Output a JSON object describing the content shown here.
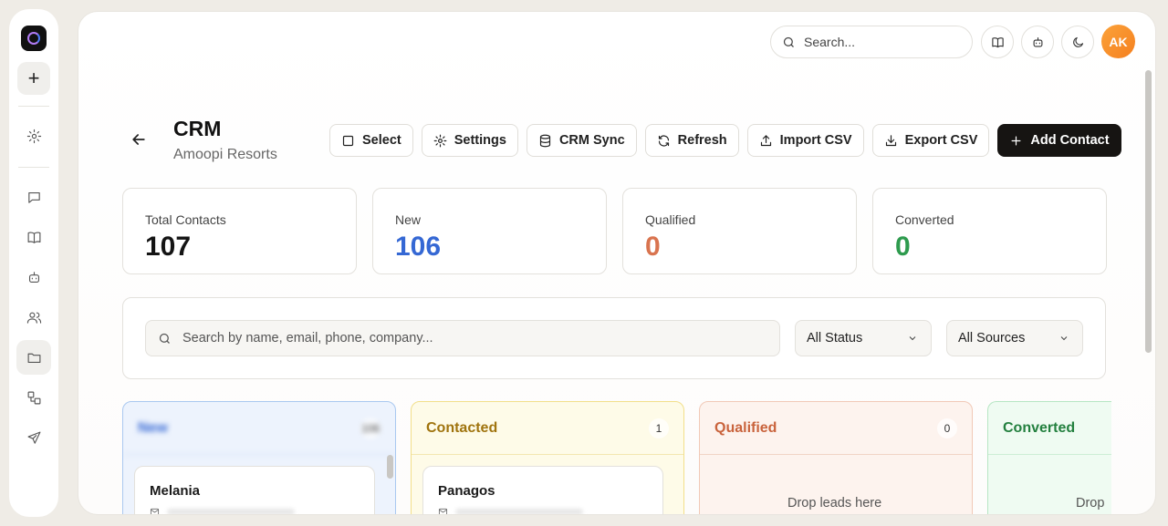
{
  "topbar": {
    "search_placeholder": "Search...",
    "avatar_initials": "AK"
  },
  "header": {
    "title": "CRM",
    "subtitle": "Amoopi Resorts"
  },
  "actions": {
    "select": "Select",
    "settings": "Settings",
    "crm_sync": "CRM Sync",
    "refresh": "Refresh",
    "import_csv": "Import CSV",
    "export_csv": "Export CSV",
    "add_contact": "Add Contact"
  },
  "stats": [
    {
      "label": "Total Contacts",
      "value": "107",
      "color": "#141414"
    },
    {
      "label": "New",
      "value": "106",
      "color": "#3568d4"
    },
    {
      "label": "Qualified",
      "value": "0",
      "color": "#d9744f"
    },
    {
      "label": "Converted",
      "value": "0",
      "color": "#2e9b4e"
    }
  ],
  "filters": {
    "search_placeholder": "Search by name, email, phone, company...",
    "status": "All Status",
    "sources": "All Sources"
  },
  "columns": {
    "new": {
      "name": "New",
      "count": "106",
      "card_name": "Melania"
    },
    "contacted": {
      "name": "Contacted",
      "count": "1",
      "color": "#a0740e",
      "card_name": "Panagos"
    },
    "qualified": {
      "name": "Qualified",
      "count": "0",
      "color": "#c9633c",
      "empty_text": "Drop leads here"
    },
    "converted": {
      "name": "Converted",
      "color": "#23803f",
      "empty_text": "Drop"
    }
  }
}
